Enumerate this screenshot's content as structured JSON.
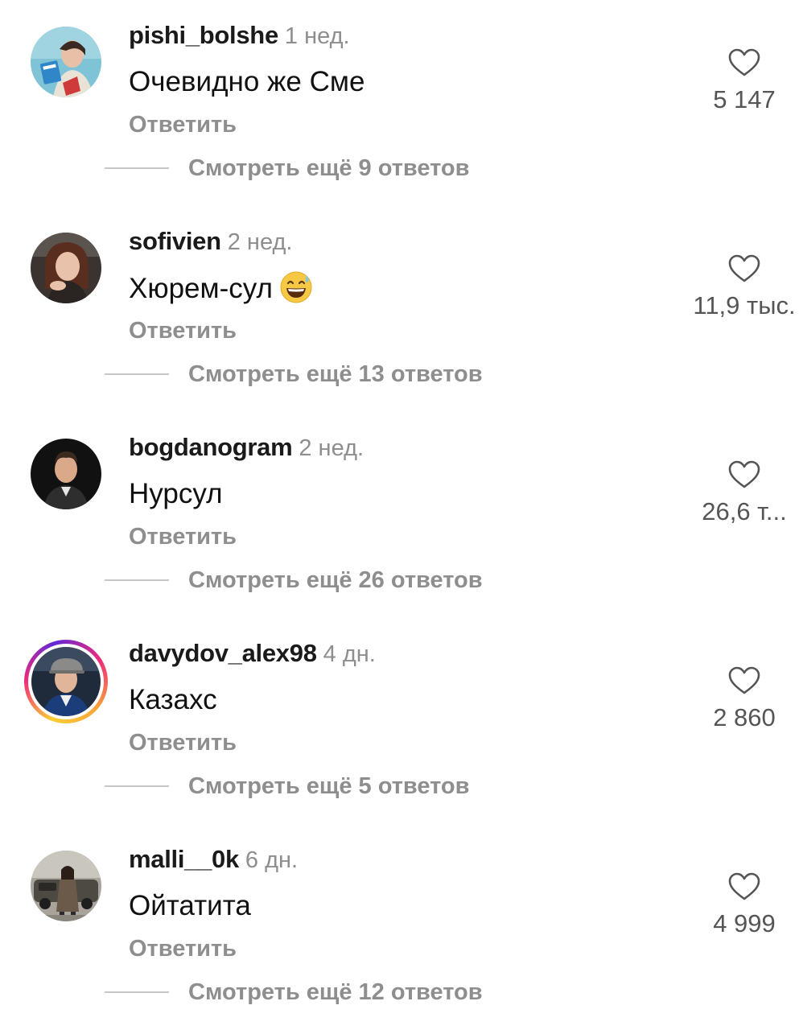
{
  "comments": [
    {
      "username": "pishi_bolshe",
      "time": "1 нед.",
      "text": "Очевидно же Сме",
      "emoji": "",
      "reply_label": "Ответить",
      "likes": "5 147",
      "more_replies": "Смотреть ещё 9 ответов",
      "has_story": false
    },
    {
      "username": "sofivien",
      "time": "2 нед.",
      "text": "Хюрем-сул",
      "emoji": "grinning-sweat-emoji",
      "reply_label": "Ответить",
      "likes": "11,9 тыс.",
      "more_replies": "Смотреть ещё 13 ответов",
      "has_story": false
    },
    {
      "username": "bogdanogram",
      "time": "2 нед.",
      "text": "Нурсул",
      "emoji": "",
      "reply_label": "Ответить",
      "likes": "26,6 т...",
      "more_replies": "Смотреть ещё 26 ответов",
      "has_story": false
    },
    {
      "username": "davydov_alex98",
      "time": "4 дн.",
      "text": "Казахс",
      "emoji": "",
      "reply_label": "Ответить",
      "likes": "2 860",
      "more_replies": "Смотреть ещё 5 ответов",
      "has_story": true
    },
    {
      "username": "malli__0k",
      "time": "6 дн.",
      "text": "Ойтатита",
      "emoji": "",
      "reply_label": "Ответить",
      "likes": "4 999",
      "more_replies": "Смотреть ещё 12 ответов",
      "has_story": false
    }
  ],
  "colors": {
    "muted_text": "#8e8e8e",
    "primary_text": "#111111",
    "divider": "#c7c7c7",
    "story_ring_start": "#f9ce34",
    "story_ring_mid": "#ee2a7b",
    "story_ring_end": "#6228d7"
  }
}
